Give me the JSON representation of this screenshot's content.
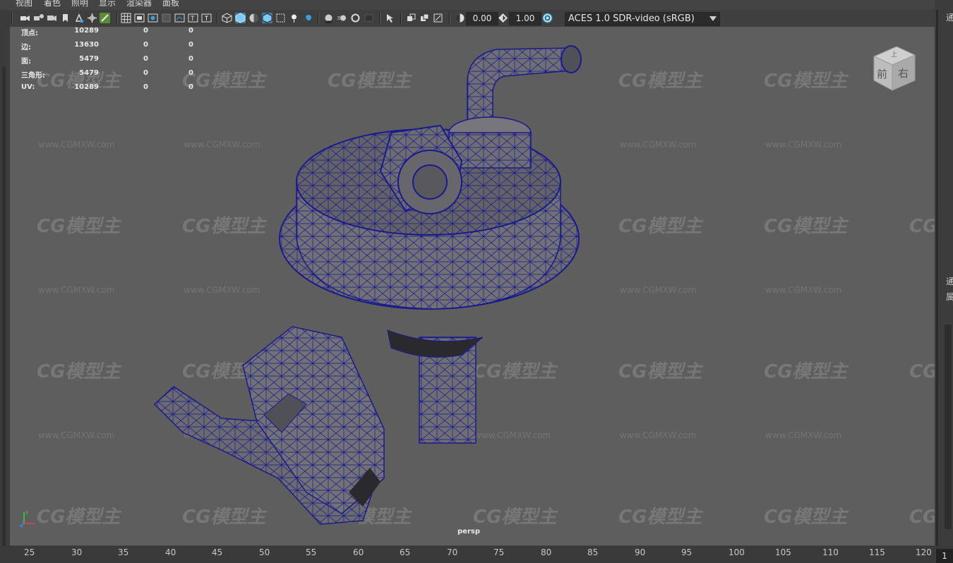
{
  "menu": [
    "视图",
    "着色",
    "照明",
    "显示",
    "渲染器",
    "面板"
  ],
  "toolbar": {
    "exposure_value": "0.00",
    "gamma_value": "1.00",
    "color_space": "ACES 1.0 SDR-video (sRGB)"
  },
  "hud": {
    "rows": [
      {
        "label": "顶点:",
        "a": "10289",
        "b": "0",
        "c": "0"
      },
      {
        "label": "边:",
        "a": "13630",
        "b": "0",
        "c": "0"
      },
      {
        "label": "面:",
        "a": "5479",
        "b": "0",
        "c": "0"
      },
      {
        "label": "三角形:",
        "a": "5479",
        "b": "0",
        "c": "0"
      },
      {
        "label": "UV:",
        "a": "10289",
        "b": "0",
        "c": "0"
      }
    ]
  },
  "viewcube": {
    "front": "前",
    "right": "右",
    "top": "上"
  },
  "camera_label": "persp",
  "watermark": {
    "logo": "CG模型主",
    "url": "www.CGMXW.com"
  },
  "right_panel": {
    "label_top": "通",
    "label_mid1": "通",
    "label_mid2": "属"
  },
  "timeline": {
    "ticks": [
      "25",
      "30",
      "35",
      "40",
      "45",
      "50",
      "55",
      "60",
      "65",
      "70",
      "75",
      "80",
      "85",
      "90",
      "95",
      "100",
      "105",
      "110",
      "115",
      "120"
    ],
    "current_frame": "1"
  },
  "colors": {
    "wire": "#1a1a8c",
    "mesh_fill": "#6e6e74",
    "viewport_bg": "#5e5e5e"
  }
}
